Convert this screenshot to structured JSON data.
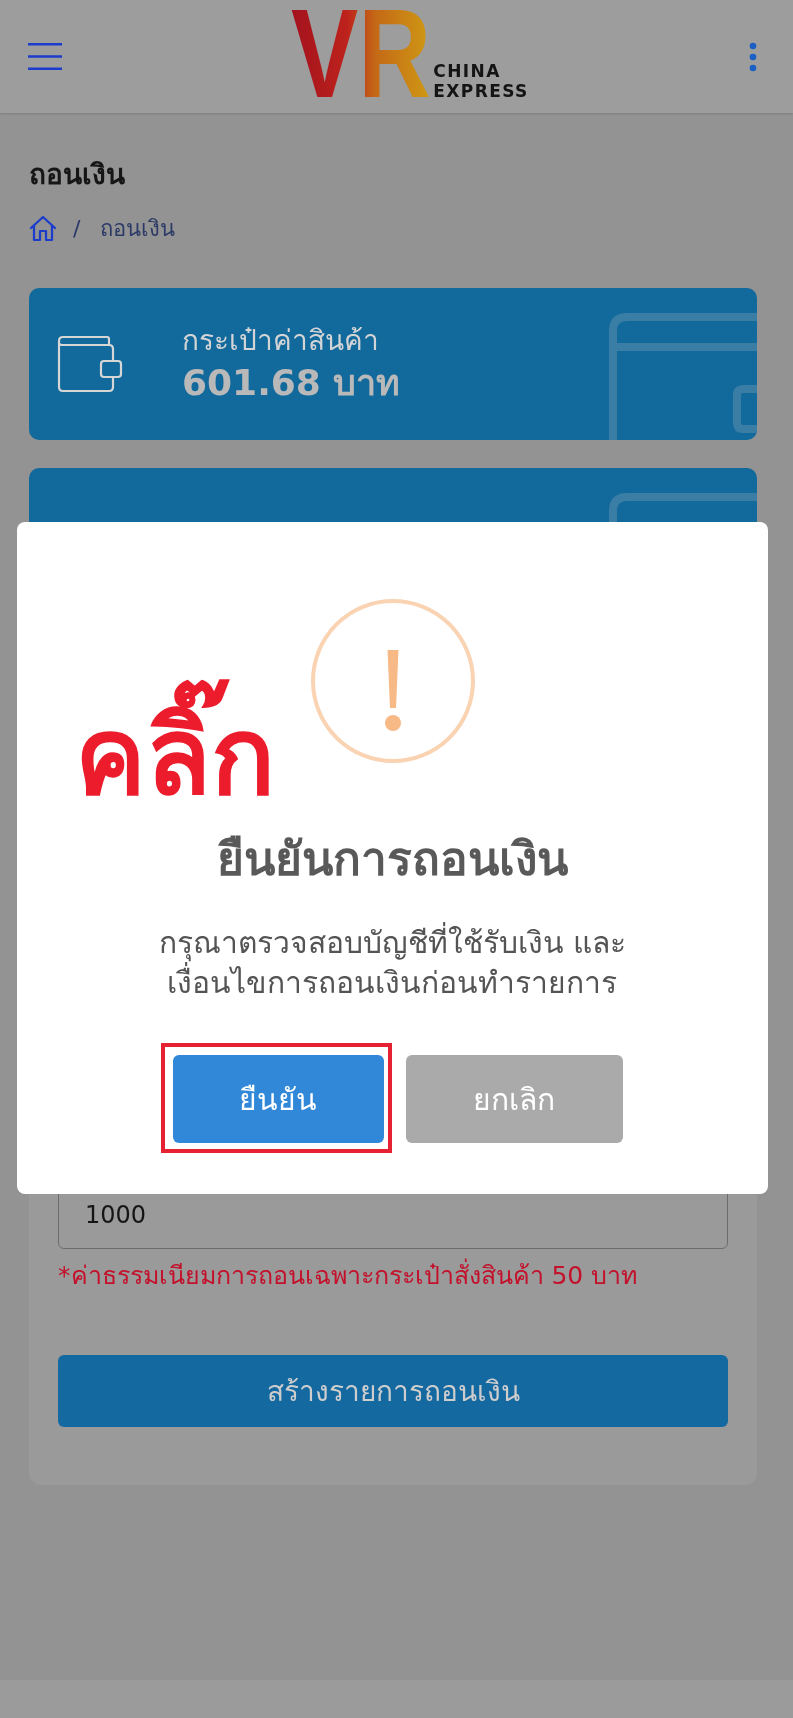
{
  "header": {
    "logo": {
      "mark": "VR",
      "lines": [
        "CHINA",
        "EXPRESS"
      ]
    }
  },
  "page": {
    "title": "ถอนเงิน",
    "breadcrumb": {
      "separator": "/",
      "current": "ถอนเงิน"
    }
  },
  "wallets": [
    {
      "label": "กระเป๋าค่าสินค้า",
      "amount": "601.68 บาท"
    }
  ],
  "form": {
    "amount_field": {
      "value": "1000"
    },
    "note": "*ค่าธรรมเนียมการถอนเฉพาะกระเป๋าสั่งสินค้า 50 บาท",
    "submit_button": "สร้างรายการถอนเงิน"
  },
  "dialog": {
    "title": "ยืนยันการถอนเงิน",
    "message_lines": [
      "กรุณาตรวจสอบบัญชีที่ใช้รับเงิน และ",
      "เงื่อนไขการถอนเงินก่อนทำรายการ"
    ],
    "buttons": [
      {
        "label": "ยืนยัน",
        "kind": "confirm",
        "highlighted": true
      },
      {
        "label": "ยกเลิก",
        "kind": "cancel",
        "highlighted": false
      }
    ]
  },
  "annotation": {
    "text": "คลิ๊ก"
  }
}
